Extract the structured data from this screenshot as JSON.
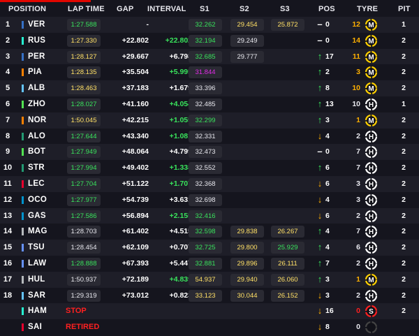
{
  "header": {
    "position": "POSITION",
    "lap_time": "LAP TIME",
    "gap": "GAP",
    "interval": "INTERVAL",
    "s1": "S1",
    "s2": "S2",
    "s3": "S3",
    "pos": "POS",
    "tyre": "TYRE",
    "pit": "PIT"
  },
  "colors": {
    "accent_red": "#e10600",
    "personal_best_green": "#39e35c",
    "fastest_purple": "#e02be6",
    "yellow": "#ffe066",
    "gain_arrow_green": "#39e35c",
    "loss_arrow_orange": "#ffb000"
  },
  "rows": [
    {
      "position": "1",
      "team_color": "#3671c6",
      "driver": "VER",
      "lap_time": "1:27.588",
      "lap_color": "green",
      "gap": "-",
      "interval": "",
      "s1": "32.262",
      "s1_color": "green",
      "s2": "29.454",
      "s2_color": "yellow",
      "s3": "25.872",
      "s3_color": "yellow",
      "arrow": "dash",
      "gained": "0",
      "tyre_laps": "12",
      "laps_color": "yellow",
      "tyre": "M",
      "pit": "1"
    },
    {
      "position": "2",
      "team_color": "#27f4d2",
      "driver": "RUS",
      "lap_time": "1:27.330",
      "lap_color": "yellow",
      "gap": "+22.802",
      "interval": "+22.802",
      "interval_color": "green",
      "s1": "32.194",
      "s1_color": "green",
      "s2": "29.249",
      "s2_color": "white",
      "s3": "",
      "s3_color": "",
      "arrow": "dash",
      "gained": "0",
      "tyre_laps": "14",
      "laps_color": "yellow",
      "tyre": "M",
      "pit": "2"
    },
    {
      "position": "3",
      "team_color": "#3671c6",
      "driver": "PER",
      "lap_time": "1:28.127",
      "lap_color": "yellow",
      "gap": "+29.667",
      "interval": "+6.798",
      "interval_color": "white",
      "s1": "32.685",
      "s1_color": "green",
      "s2": "29.777",
      "s2_color": "white",
      "s3": "",
      "s3_color": "",
      "arrow": "up",
      "gained": "17",
      "tyre_laps": "11",
      "laps_color": "yellow",
      "tyre": "M",
      "pit": "2"
    },
    {
      "position": "4",
      "team_color": "#ff8000",
      "driver": "PIA",
      "lap_time": "1:28.135",
      "lap_color": "yellow",
      "gap": "+35.504",
      "interval": "+5.995",
      "interval_color": "green",
      "s1": "31.844",
      "s1_color": "purple",
      "s2": "",
      "s2_color": "",
      "s3": "",
      "s3_color": "",
      "arrow": "up",
      "gained": "2",
      "tyre_laps": "3",
      "laps_color": "yellow",
      "tyre": "M",
      "pit": "2"
    },
    {
      "position": "5",
      "team_color": "#64c4ff",
      "driver": "ALB",
      "lap_time": "1:28.463",
      "lap_color": "yellow",
      "gap": "+37.183",
      "interval": "+1.679",
      "interval_color": "white",
      "s1": "33.396",
      "s1_color": "white",
      "s2": "",
      "s2_color": "",
      "s3": "",
      "s3_color": "",
      "arrow": "up",
      "gained": "8",
      "tyre_laps": "10",
      "laps_color": "yellow",
      "tyre": "M",
      "pit": "2"
    },
    {
      "position": "6",
      "team_color": "#52e252",
      "driver": "ZHO",
      "lap_time": "1:28.027",
      "lap_color": "green",
      "gap": "+41.160",
      "interval": "+4.054",
      "interval_color": "green",
      "s1": "32.485",
      "s1_color": "white",
      "s2": "",
      "s2_color": "",
      "s3": "",
      "s3_color": "",
      "arrow": "up",
      "gained": "13",
      "tyre_laps": "10",
      "laps_color": "white",
      "tyre": "H",
      "pit": "1"
    },
    {
      "position": "7",
      "team_color": "#ff8000",
      "driver": "NOR",
      "lap_time": "1:50.045",
      "lap_color": "yellow",
      "gap": "+42.215",
      "interval": "+1.055",
      "interval_color": "green",
      "s1": "32.299",
      "s1_color": "green",
      "s2": "",
      "s2_color": "",
      "s3": "",
      "s3_color": "",
      "arrow": "up",
      "gained": "3",
      "tyre_laps": "1",
      "laps_color": "yellow",
      "tyre": "M",
      "pit": "2"
    },
    {
      "position": "8",
      "team_color": "#229971",
      "driver": "ALO",
      "lap_time": "1:27.644",
      "lap_color": "green",
      "gap": "+43.340",
      "interval": "+1.081",
      "interval_color": "green",
      "s1": "32.331",
      "s1_color": "white",
      "s2": "",
      "s2_color": "",
      "s3": "",
      "s3_color": "",
      "arrow": "down",
      "gained": "4",
      "tyre_laps": "2",
      "laps_color": "white",
      "tyre": "H",
      "pit": "2"
    },
    {
      "position": "9",
      "team_color": "#52e252",
      "driver": "BOT",
      "lap_time": "1:27.949",
      "lap_color": "green",
      "gap": "+48.064",
      "interval": "+4.799",
      "interval_color": "white",
      "s1": "32.473",
      "s1_color": "white",
      "s2": "",
      "s2_color": "",
      "s3": "",
      "s3_color": "",
      "arrow": "dash",
      "gained": "0",
      "tyre_laps": "7",
      "laps_color": "white",
      "tyre": "H",
      "pit": "2"
    },
    {
      "position": "10",
      "team_color": "#229971",
      "driver": "STR",
      "lap_time": "1:27.994",
      "lap_color": "green",
      "gap": "+49.402",
      "interval": "+1.338",
      "interval_color": "green",
      "s1": "32.552",
      "s1_color": "white",
      "s2": "",
      "s2_color": "",
      "s3": "",
      "s3_color": "",
      "arrow": "up",
      "gained": "6",
      "tyre_laps": "7",
      "laps_color": "white",
      "tyre": "H",
      "pit": "2"
    },
    {
      "position": "11",
      "team_color": "#e8002d",
      "driver": "LEC",
      "lap_time": "1:27.704",
      "lap_color": "green",
      "gap": "+51.122",
      "interval": "+1.707",
      "interval_color": "green",
      "s1": "32.368",
      "s1_color": "white",
      "s2": "",
      "s2_color": "",
      "s3": "",
      "s3_color": "",
      "arrow": "down",
      "gained": "6",
      "tyre_laps": "3",
      "laps_color": "white",
      "tyre": "H",
      "pit": "2"
    },
    {
      "position": "12",
      "team_color": "#0093cc",
      "driver": "OCO",
      "lap_time": "1:27.977",
      "lap_color": "green",
      "gap": "+54.739",
      "interval": "+3.631",
      "interval_color": "white",
      "s1": "32.698",
      "s1_color": "white",
      "s2": "",
      "s2_color": "",
      "s3": "",
      "s3_color": "",
      "arrow": "down",
      "gained": "4",
      "tyre_laps": "3",
      "laps_color": "white",
      "tyre": "H",
      "pit": "2"
    },
    {
      "position": "13",
      "team_color": "#0093cc",
      "driver": "GAS",
      "lap_time": "1:27.586",
      "lap_color": "green",
      "gap": "+56.894",
      "interval": "+2.155",
      "interval_color": "green",
      "s1": "32.416",
      "s1_color": "green",
      "s2": "",
      "s2_color": "",
      "s3": "",
      "s3_color": "",
      "arrow": "down",
      "gained": "6",
      "tyre_laps": "2",
      "laps_color": "white",
      "tyre": "H",
      "pit": "2"
    },
    {
      "position": "14",
      "team_color": "#b6babd",
      "driver": "MAG",
      "lap_time": "1:28.703",
      "lap_color": "white",
      "gap": "+61.402",
      "interval": "+4.515",
      "interval_color": "white",
      "s1": "32.598",
      "s1_color": "green",
      "s2": "29.838",
      "s2_color": "yellow",
      "s3": "26.267",
      "s3_color": "yellow",
      "arrow": "up",
      "gained": "4",
      "tyre_laps": "7",
      "laps_color": "white",
      "tyre": "H",
      "pit": "2"
    },
    {
      "position": "15",
      "team_color": "#6692ff",
      "driver": "TSU",
      "lap_time": "1:28.454",
      "lap_color": "white",
      "gap": "+62.109",
      "interval": "+0.707",
      "interval_color": "white",
      "s1": "32.725",
      "s1_color": "green",
      "s2": "29.800",
      "s2_color": "yellow",
      "s3": "25.929",
      "s3_color": "green",
      "arrow": "up",
      "gained": "4",
      "tyre_laps": "6",
      "laps_color": "white",
      "tyre": "H",
      "pit": "2"
    },
    {
      "position": "16",
      "team_color": "#6692ff",
      "driver": "LAW",
      "lap_time": "1:28.888",
      "lap_color": "green",
      "gap": "+67.393",
      "interval": "+5.447",
      "interval_color": "white",
      "s1": "32.881",
      "s1_color": "green",
      "s2": "29.896",
      "s2_color": "yellow",
      "s3": "26.111",
      "s3_color": "yellow",
      "arrow": "up",
      "gained": "7",
      "tyre_laps": "2",
      "laps_color": "white",
      "tyre": "H",
      "pit": "2"
    },
    {
      "position": "17",
      "team_color": "#b6babd",
      "driver": "HUL",
      "lap_time": "1:50.937",
      "lap_color": "white",
      "gap": "+72.189",
      "interval": "+4.839",
      "interval_color": "green",
      "s1": "54.937",
      "s1_color": "yellow",
      "s2": "29.940",
      "s2_color": "yellow",
      "s3": "26.060",
      "s3_color": "yellow",
      "arrow": "up",
      "gained": "3",
      "tyre_laps": "1",
      "laps_color": "yellow",
      "tyre": "M",
      "pit": "2"
    },
    {
      "position": "18",
      "team_color": "#64c4ff",
      "driver": "SAR",
      "lap_time": "1:29.319",
      "lap_color": "white",
      "gap": "+73.012",
      "interval": "+0.823",
      "interval_color": "white",
      "s1": "33.123",
      "s1_color": "yellow",
      "s2": "30.044",
      "s2_color": "yellow",
      "s3": "26.152",
      "s3_color": "yellow",
      "arrow": "down",
      "gained": "3",
      "tyre_laps": "2",
      "laps_color": "white",
      "tyre": "H",
      "pit": "2"
    },
    {
      "position": "",
      "team_color": "#27f4d2",
      "driver": "HAM",
      "lap_time": "STOP",
      "lap_color": "red",
      "gap": "",
      "interval": "",
      "interval_color": "",
      "s1": "",
      "s1_color": "",
      "s2": "",
      "s2_color": "",
      "s3": "",
      "s3_color": "",
      "arrow": "down",
      "gained": "16",
      "tyre_laps": "0",
      "laps_color": "red",
      "tyre": "S",
      "pit": "2"
    },
    {
      "position": "",
      "team_color": "#e8002d",
      "driver": "SAI",
      "lap_time": "RETIRED",
      "lap_color": "red",
      "gap": "",
      "interval": "",
      "interval_color": "",
      "s1": "",
      "s1_color": "",
      "s2": "",
      "s2_color": "",
      "s3": "",
      "s3_color": "",
      "arrow": "down",
      "gained": "8",
      "tyre_laps": "0",
      "laps_color": "white",
      "tyre": "",
      "pit": ""
    }
  ],
  "tyre_compounds": {
    "M": {
      "label": "M",
      "ring": "#ffd000"
    },
    "H": {
      "label": "H",
      "ring": "#ffffff"
    },
    "S": {
      "label": "S",
      "ring": "#ff2020"
    }
  },
  "arrow_glyphs": {
    "up": "↑",
    "down": "↓",
    "dash": "–"
  }
}
